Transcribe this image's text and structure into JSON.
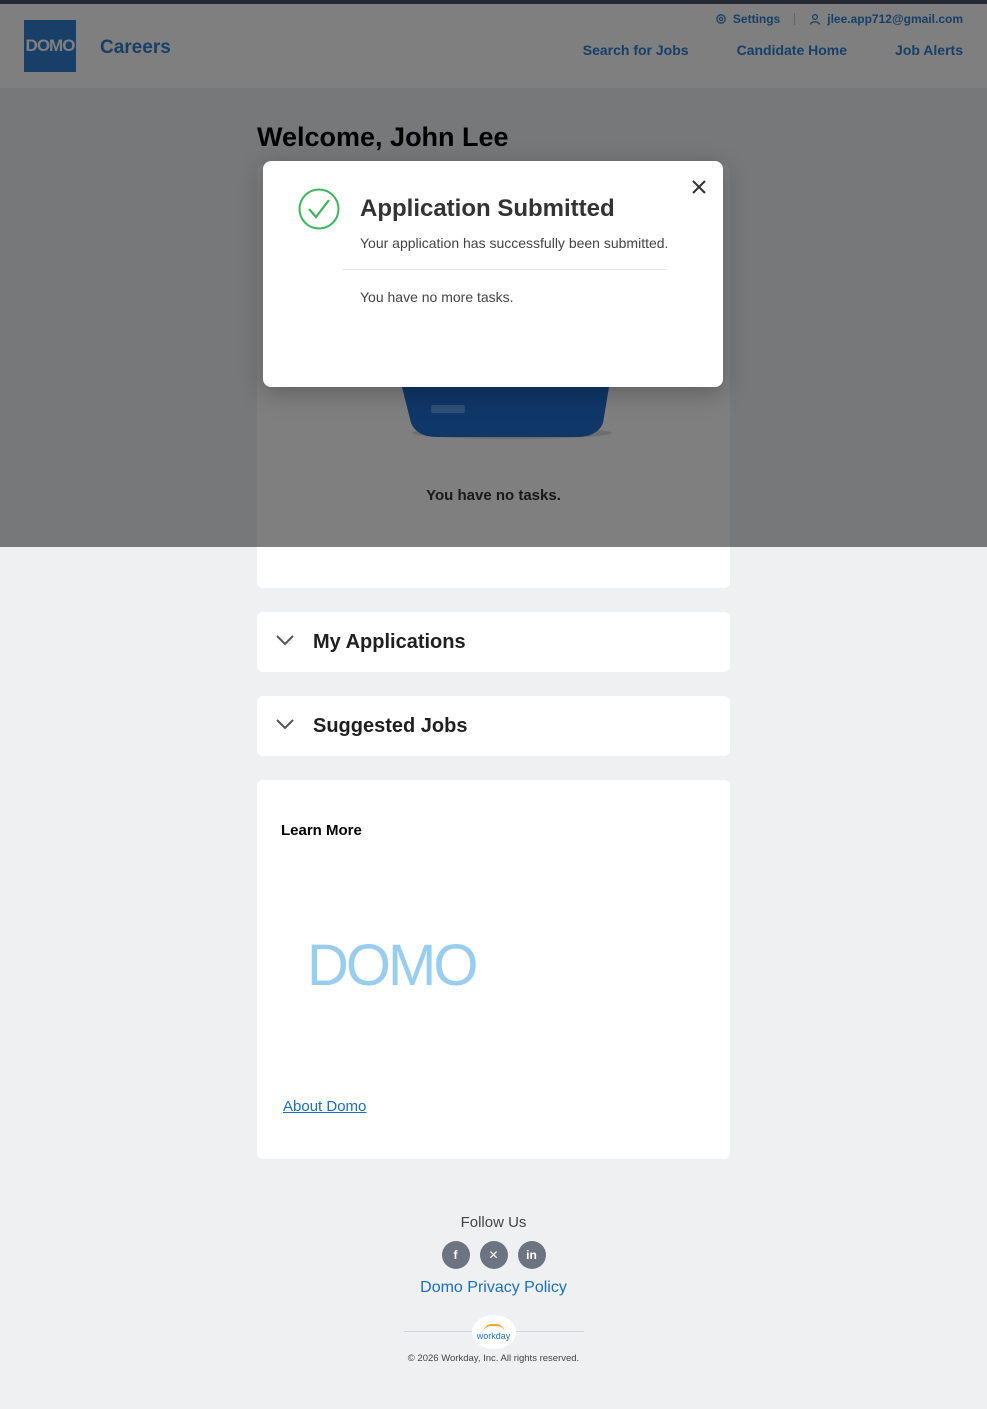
{
  "header": {
    "logo_text": "DOMO",
    "brand": "Careers",
    "settings_label": "Settings",
    "user_email": "jlee.app712@gmail.com",
    "nav": [
      "Search for Jobs",
      "Candidate Home",
      "Job Alerts"
    ]
  },
  "welcome": "Welcome, John Lee",
  "tasks": {
    "empty_label": "You have no tasks."
  },
  "sections": {
    "my_applications": "My Applications",
    "suggested_jobs": "Suggested Jobs"
  },
  "learn_more": {
    "title": "Learn More",
    "logo_text": "DOMO",
    "about_link": "About Domo"
  },
  "footer": {
    "follow_us": "Follow Us",
    "socials": [
      "facebook",
      "x",
      "linkedin"
    ],
    "privacy_policy": "Domo Privacy Policy",
    "workday_logo": "workday",
    "copyright": "© 2026 Workday, Inc. All rights reserved."
  },
  "modal": {
    "title": "Application Submitted",
    "message": "Your application has successfully been submitted.",
    "sub_message": "You have no more tasks."
  },
  "colors": {
    "accent": "#2f7fd0",
    "success": "#3cb55a",
    "link": "#1a6ec0"
  }
}
